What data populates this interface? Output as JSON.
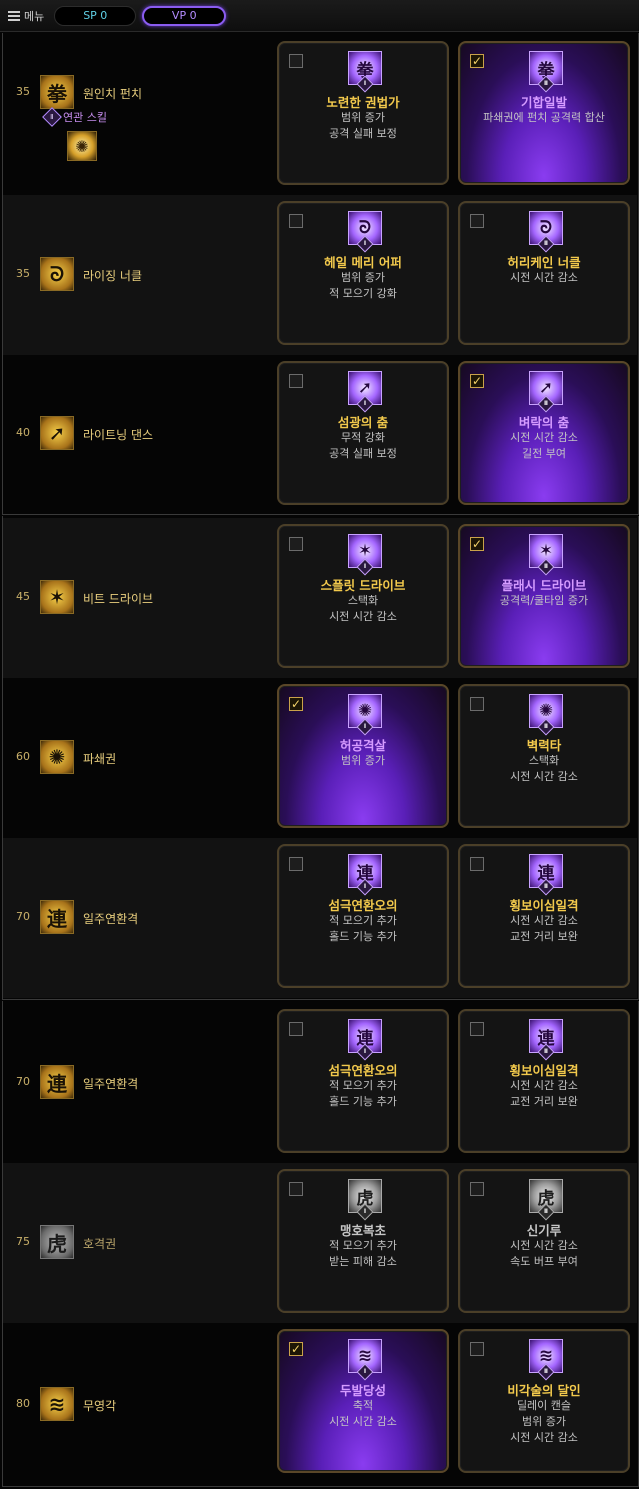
{
  "topbar": {
    "menu_label": "메뉴",
    "sp_label": "SP 0",
    "vp_label": "VP 0"
  },
  "related_label": "연관 스킬",
  "rows": [
    {
      "level": "35",
      "name": "원인치 펀치",
      "icon": "fist-icon",
      "cards": [
        {
          "title": "노련한 권법가",
          "desc": [
            "범위 증가",
            "공격 실패 보정"
          ],
          "checked": false,
          "selected": false,
          "numeral": "Ⅰ"
        },
        {
          "title": "기합일발",
          "desc": [
            "파쇄권에 펀치 공격력 합산"
          ],
          "checked": true,
          "selected": true,
          "numeral": "Ⅱ"
        }
      ]
    },
    {
      "level": "35",
      "name": "라이징 너클",
      "icon": "rising-knuckle-icon",
      "cards": [
        {
          "title": "헤일 메리 어퍼",
          "desc": [
            "범위 증가",
            "적 모으기 강화"
          ],
          "checked": false,
          "selected": false,
          "numeral": "Ⅰ"
        },
        {
          "title": "허리케인 너클",
          "desc": [
            "시전 시간 감소"
          ],
          "checked": false,
          "selected": false,
          "numeral": "Ⅱ"
        }
      ]
    },
    {
      "level": "40",
      "name": "라이트닝 댄스",
      "icon": "lightning-dance-icon",
      "cards": [
        {
          "title": "섬광의 춤",
          "desc": [
            "무적 강화",
            "공격 실패 보정"
          ],
          "checked": false,
          "selected": false,
          "numeral": "Ⅰ"
        },
        {
          "title": "벼락의 춤",
          "desc": [
            "시전 시간 감소",
            "길전 부여"
          ],
          "checked": true,
          "selected": true,
          "numeral": "Ⅱ"
        }
      ]
    },
    {
      "level": "45",
      "name": "비트 드라이브",
      "icon": "beat-drive-icon",
      "cards": [
        {
          "title": "스플릿 드라이브",
          "desc": [
            "스택화",
            "시전 시간 감소"
          ],
          "checked": false,
          "selected": false,
          "numeral": "Ⅰ"
        },
        {
          "title": "플래시 드라이브",
          "desc": [
            "공격력/쿨타임 증가"
          ],
          "checked": true,
          "selected": true,
          "numeral": "Ⅱ"
        }
      ]
    },
    {
      "level": "60",
      "name": "파쇄권",
      "icon": "shatter-fist-icon",
      "cards": [
        {
          "title": "허공격살",
          "desc": [
            "범위 증가"
          ],
          "checked": true,
          "selected": true,
          "numeral": "Ⅰ"
        },
        {
          "title": "벽력타",
          "desc": [
            "스택화",
            "시전 시간 감소"
          ],
          "checked": false,
          "selected": false,
          "numeral": "Ⅱ"
        }
      ]
    },
    {
      "level": "70",
      "name": "일주연환격",
      "icon": "chain-strike-icon",
      "cards": [
        {
          "title": "섬극연환오의",
          "desc": [
            "적 모으기 추가",
            "홀드 기능 추가"
          ],
          "checked": false,
          "selected": false,
          "numeral": "Ⅰ"
        },
        {
          "title": "횡보이심일격",
          "desc": [
            "시전 시간 감소",
            "교전 거리 보완"
          ],
          "checked": false,
          "selected": false,
          "numeral": "Ⅱ"
        }
      ]
    },
    {
      "level": "70",
      "name": "일주연환격",
      "icon": "chain-strike-icon",
      "cards": [
        {
          "title": "섬극연환오의",
          "desc": [
            "적 모으기 추가",
            "홀드 기능 추가"
          ],
          "checked": false,
          "selected": false,
          "numeral": "Ⅰ"
        },
        {
          "title": "횡보이심일격",
          "desc": [
            "시전 시간 감소",
            "교전 거리 보완"
          ],
          "checked": false,
          "selected": false,
          "numeral": "Ⅱ"
        }
      ]
    },
    {
      "level": "75",
      "name": "호격권",
      "icon": "tiger-fist-icon",
      "gray": true,
      "cards": [
        {
          "title": "맹호복초",
          "desc": [
            "적 모으기 추가",
            "받는 피해 감소"
          ],
          "checked": false,
          "selected": false,
          "numeral": "Ⅰ"
        },
        {
          "title": "신기루",
          "desc": [
            "시전 시간 감소",
            "속도 버프 부여"
          ],
          "checked": false,
          "selected": false,
          "numeral": "Ⅱ"
        }
      ]
    },
    {
      "level": "80",
      "name": "무영각",
      "icon": "shadowless-kick-icon",
      "cards": [
        {
          "title": "두발당성",
          "desc": [
            "축적",
            "시전 시간 감소"
          ],
          "checked": true,
          "selected": true,
          "numeral": "Ⅰ"
        },
        {
          "title": "비각술의 달인",
          "desc": [
            "딜레이 캔슬",
            "범위 증가",
            "시전 시간 감소"
          ],
          "checked": false,
          "selected": false,
          "numeral": "Ⅱ"
        }
      ]
    }
  ]
}
